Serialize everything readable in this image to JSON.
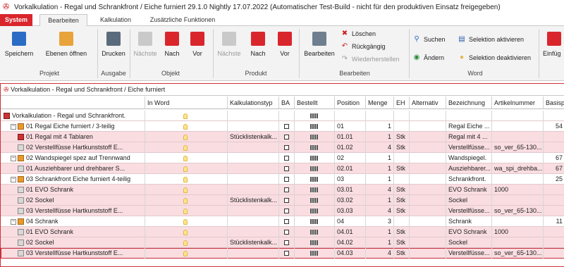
{
  "window": {
    "title": "Vorkalkulation - Regal und Schrankfront / Eiche furniert  29.1.0 Nightly 17.07.2022 (Automatischer Test-Build - nicht für den produktiven Einsatz freigegeben)"
  },
  "tabs": [
    "System",
    "Bearbeiten",
    "Kalkulation",
    "Zusätzliche Funktionen"
  ],
  "ribbon": {
    "speichern": "Speichern",
    "ebenen": "Ebenen öffnen",
    "drucken": "Drucken",
    "objekt_naechste": "Nächste",
    "objekt_nach": "Nach",
    "objekt_vor": "Vor",
    "produkt_naechste": "Nächste",
    "produkt_nach": "Nach",
    "produkt_vor": "Vor",
    "bearbeiten": "Bearbeiten",
    "loeschen": "Löschen",
    "rueckgaengig": "Rückgängig",
    "wiederherstellen": "Wiederherstellen",
    "suchen": "Suchen",
    "aendern": "Ändern",
    "sel_akt": "Selektion aktivieren",
    "sel_deakt": "Selektion deaktivieren",
    "einfuegen": "Einfüg",
    "groups": {
      "projekt": "Projekt",
      "ausgabe": "Ausgabe",
      "objekt": "Objekt",
      "produkt": "Produkt",
      "bearbeiten": "Bearbeiten",
      "word": "Word"
    }
  },
  "panel": {
    "title": "Vorkalkulation - Regal und Schrankfront / Eiche furniert"
  },
  "columns": [
    "In Word",
    "Kalkulationstyp",
    "BA",
    "Bestellt",
    "Position",
    "Menge",
    "EH",
    "Alternativ",
    "Bezeichnung",
    "Artikelnummer",
    "Basisp"
  ],
  "rows": [
    {
      "name": "Vorkalkulation  - Regal und Schrankfront.",
      "pos": "",
      "menge": "",
      "eh": "",
      "bez": "",
      "art": "",
      "basis": "",
      "typ": "",
      "ic": "root"
    },
    {
      "name": "01 Regal Eiche furniert / 3-teilig",
      "pos": "01",
      "menge": "1",
      "eh": "",
      "bez": "Regal Eiche ...",
      "art": "",
      "basis": "54",
      "typ": "",
      "ic": "o"
    },
    {
      "name": "01 Regal mit 4 Tablaren",
      "pos": "01.01",
      "menge": "1",
      "eh": "Stk",
      "bez": "Regal mit 4 ...",
      "art": "",
      "basis": "",
      "typ": "Stücklistenkalk...",
      "ic": "r"
    },
    {
      "name": "02 Verstellfüsse Hartkunststoff E...",
      "pos": "01.02",
      "menge": "4",
      "eh": "Stk",
      "bez": "Verstellfüsse...",
      "art": "so_ver_65-130...",
      "basis": "",
      "typ": "",
      "ic": "g"
    },
    {
      "name": "02 Wandspiegel spez auf Trennwand",
      "pos": "02",
      "menge": "1",
      "eh": "",
      "bez": "Wandspiegel.",
      "art": "",
      "basis": "67",
      "typ": "",
      "ic": "o"
    },
    {
      "name": "01 Ausziehbarer und drehbarer S...",
      "pos": "02.01",
      "menge": "1",
      "eh": "Stk",
      "bez": "Ausziehbarer...",
      "art": "wa_spi_drehba...",
      "basis": "67",
      "typ": "",
      "ic": "g"
    },
    {
      "name": "03 Schrankfront Eiche furniert 4-teilig",
      "pos": "03",
      "menge": "1",
      "eh": "",
      "bez": "Schrankfront.",
      "art": "",
      "basis": "25",
      "typ": "",
      "ic": "o"
    },
    {
      "name": "01 EVO Schrank",
      "pos": "03.01",
      "menge": "4",
      "eh": "Stk",
      "bez": "EVO Schrank",
      "art": "1000",
      "basis": "",
      "typ": "",
      "ic": "g"
    },
    {
      "name": "02 Sockel",
      "pos": "03.02",
      "menge": "1",
      "eh": "Stk",
      "bez": "Sockel",
      "art": "",
      "basis": "",
      "typ": "Stücklistenkalk...",
      "ic": "g"
    },
    {
      "name": "03 Verstellfüsse Hartkunststoff E...",
      "pos": "03.03",
      "menge": "4",
      "eh": "Stk",
      "bez": "Verstellfüsse...",
      "art": "so_ver_65-130...",
      "basis": "",
      "typ": "",
      "ic": "g"
    },
    {
      "name": "04 Schrank",
      "pos": "04",
      "menge": "3",
      "eh": "",
      "bez": "Schrank",
      "art": "",
      "basis": "11",
      "typ": "",
      "ic": "o"
    },
    {
      "name": "01 EVO Schrank",
      "pos": "04.01",
      "menge": "1",
      "eh": "Stk",
      "bez": "EVO Schrank",
      "art": "1000",
      "basis": "",
      "typ": "",
      "ic": "g"
    },
    {
      "name": "02 Sockel",
      "pos": "04.02",
      "menge": "1",
      "eh": "Stk",
      "bez": "Sockel",
      "art": "",
      "basis": "",
      "typ": "Stücklistenkalk...",
      "ic": "g"
    },
    {
      "name": "03 Verstellfüsse Hartkunststoff E...",
      "pos": "04.03",
      "menge": "4",
      "eh": "Stk",
      "bez": "Verstellfüsse...",
      "art": "so_ver_65-130...",
      "basis": "",
      "typ": "",
      "ic": "g"
    }
  ],
  "colors": {
    "accent": "#d9262c",
    "row_highlight": "#f9dde1"
  }
}
